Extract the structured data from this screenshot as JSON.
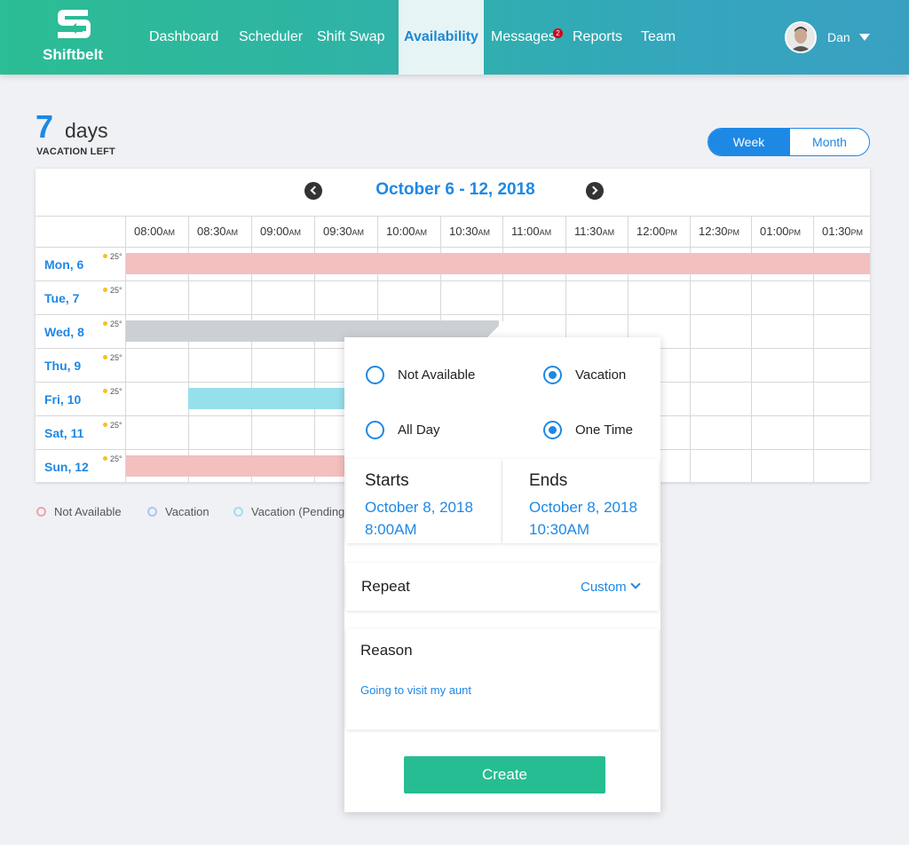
{
  "app": {
    "name": "Shiftbelt"
  },
  "nav": {
    "items": [
      {
        "label": "Dashboard"
      },
      {
        "label": "Scheduler"
      },
      {
        "label": "Shift Swap"
      },
      {
        "label": "Availability"
      },
      {
        "label": "Messages",
        "badge": "2"
      },
      {
        "label": "Reports"
      },
      {
        "label": "Team"
      }
    ],
    "active": "Availability"
  },
  "user": {
    "name": "Dan"
  },
  "vacation": {
    "count": "7",
    "unit": "days",
    "label": "VACATION LEFT"
  },
  "view_toggle": {
    "options": [
      "Week",
      "Month"
    ],
    "selected": "Week"
  },
  "calendar": {
    "range_title": "October 6 - 12, 2018",
    "times": [
      {
        "time": "08:00",
        "ampm": "AM"
      },
      {
        "time": "08:30",
        "ampm": "AM"
      },
      {
        "time": "09:00",
        "ampm": "AM"
      },
      {
        "time": "09:30",
        "ampm": "AM"
      },
      {
        "time": "10:00",
        "ampm": "AM"
      },
      {
        "time": "10:30",
        "ampm": "AM"
      },
      {
        "time": "11:00",
        "ampm": "AM"
      },
      {
        "time": "11:30",
        "ampm": "AM"
      },
      {
        "time": "12:00",
        "ampm": "PM"
      },
      {
        "time": "12:30",
        "ampm": "PM"
      },
      {
        "time": "01:00",
        "ampm": "PM"
      },
      {
        "time": "01:30",
        "ampm": "PM"
      }
    ],
    "days": [
      {
        "label": "Mon, 6",
        "temp": "25°"
      },
      {
        "label": "Tue, 7",
        "temp": "25°"
      },
      {
        "label": "Wed, 8",
        "temp": "25°"
      },
      {
        "label": "Thu, 9",
        "temp": "25°"
      },
      {
        "label": "Fri, 10",
        "temp": "25°"
      },
      {
        "label": "Sat, 11",
        "temp": "25°"
      },
      {
        "label": "Sun, 12",
        "temp": "25°"
      }
    ],
    "events": [
      {
        "day": "Mon, 6",
        "type": "Not Available",
        "color": "#f4bfbf"
      },
      {
        "day": "Wed, 8",
        "type": "Vacation (pending)",
        "color": "#ccd0d5"
      },
      {
        "day": "Fri, 10",
        "type": "Vacation (pending)",
        "color": "#96e0ec"
      },
      {
        "day": "Sun, 12",
        "type": "Not Available",
        "color": "#f4bfbf"
      }
    ]
  },
  "legend": {
    "not_available": {
      "label": "Not Available",
      "color": "#f4a3a3"
    },
    "vacation": {
      "label": "Vacation",
      "color": "#a9c6f2"
    },
    "vacation_pending": {
      "label": "Vacation (Pending)",
      "color": "#9fe0ec"
    }
  },
  "popup": {
    "type_options": [
      "Not Available",
      "Vacation"
    ],
    "type_selected": "Vacation",
    "duration_options": [
      "All Day",
      "One Time"
    ],
    "duration_selected": "One Time",
    "starts": {
      "label": "Starts",
      "date": "October 8, 2018",
      "time": "8:00AM"
    },
    "ends": {
      "label": "Ends",
      "date": "October 8, 2018",
      "time": "10:30AM"
    },
    "repeat": {
      "label": "Repeat",
      "value": "Custom"
    },
    "reason": {
      "label": "Reason",
      "value": "Going to visit my aunt"
    },
    "create_label": "Create"
  },
  "colors": {
    "accent": "#1e88e5",
    "brand_green": "#27bd93",
    "badge": "#d0021b"
  }
}
